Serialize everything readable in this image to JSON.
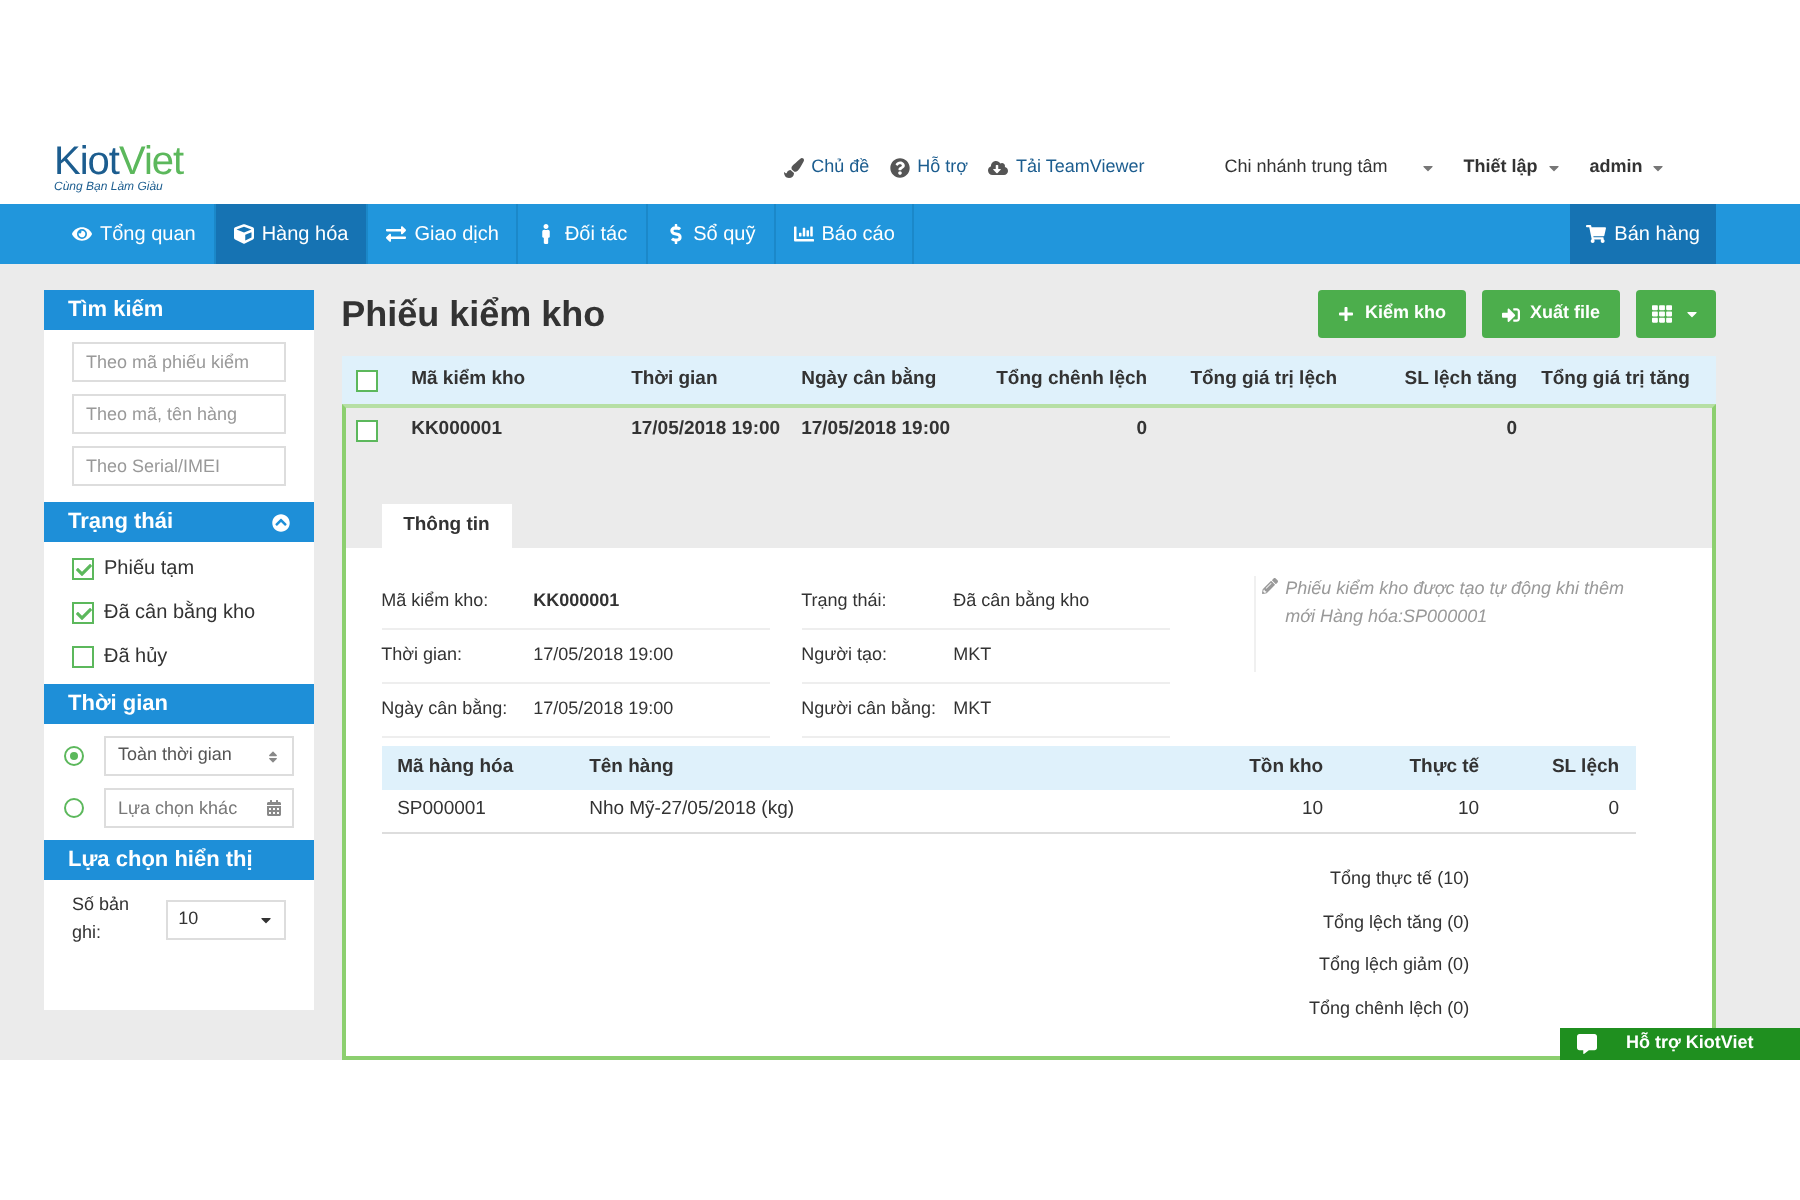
{
  "logo": {
    "part_1": "Kiot",
    "part_2": "Viet",
    "tagline": "Cùng Bạn Làm Giàu"
  },
  "header_links": [
    "Chủ đề",
    "Hỗ trợ",
    "Tải TeamViewer"
  ],
  "header_menus": [
    "Chi nhánh trung tâm",
    "Thiết lập",
    "admin"
  ],
  "nav": [
    {
      "label": "Tổng quan",
      "selected": false
    },
    {
      "label": "Hàng hóa",
      "selected": true
    },
    {
      "label": "Giao dịch",
      "selected": false
    },
    {
      "label": "Đối tác",
      "selected": false
    },
    {
      "label": "Sổ quỹ",
      "selected": false
    },
    {
      "label": "Báo cáo",
      "selected": false
    }
  ],
  "sell_button": "Bán hàng",
  "sidebar": {
    "search": {
      "title": "Tìm kiếm",
      "fields": [
        {
          "placeholder": "Theo mã phiếu kiểm"
        },
        {
          "placeholder": "Theo mã, tên hàng"
        },
        {
          "placeholder": "Theo Serial/IMEI"
        }
      ]
    },
    "status": {
      "title": "Trạng thái",
      "expanded": true,
      "options": [
        {
          "label": "Phiếu tạm",
          "checked": true
        },
        {
          "label": "Đã cân bằng kho",
          "checked": true
        },
        {
          "label": "Đã hủy",
          "checked": false
        }
      ]
    },
    "time": {
      "title": "Thời gian",
      "options": [
        {
          "kind": "select",
          "value": "Toàn thời gian",
          "selected": true
        },
        {
          "kind": "date",
          "placeholder": "Lựa chọn khác",
          "selected": false
        }
      ]
    },
    "display": {
      "title": "Lựa chọn hiển thị",
      "label": "Số bản ghi:",
      "value": "10"
    }
  },
  "page_title": "Phiếu kiểm kho",
  "actions": [
    "Kiểm kho",
    "Xuất file"
  ],
  "table": {
    "checked": false,
    "columns": [
      "Mã kiểm kho",
      "Thời gian",
      "Ngày cân bằng",
      "Tổng chênh lệch",
      "Tổng giá trị lệch",
      "SL lệch tăng",
      "Tổng giá trị tăng"
    ],
    "rows": [
      {
        "checked": false,
        "expanded": true,
        "cells": [
          "KK000001",
          "17/05/2018 19:00",
          "17/05/2018 19:00",
          "0",
          null,
          "0",
          null
        ]
      }
    ]
  },
  "detail": {
    "tabs": [
      {
        "label": "Thông tin",
        "selected": true
      }
    ],
    "fields": [
      {
        "label": "Mã kiểm kho:",
        "value": "KK000001",
        "bold": true
      },
      {
        "label": "Trạng thái:",
        "value": "Đã cân bằng kho",
        "bold": false
      },
      {
        "label": "Thời gian:",
        "value": "17/05/2018 19:00",
        "bold": false
      },
      {
        "label": "Người tạo:",
        "value": "MKT",
        "bold": false
      },
      {
        "label": "Ngày cân bằng:",
        "value": "17/05/2018 19:00",
        "bold": false
      },
      {
        "label": "Người cân bằng:",
        "value": "MKT",
        "bold": false
      }
    ],
    "note": "Phiếu kiểm kho được tạo tự động khi thêm mới Hàng hóa:SP000001",
    "items": {
      "columns": [
        "Mã hàng hóa",
        "Tên hàng",
        "Tồn kho",
        "Thực tế",
        "SL lệch"
      ],
      "rows": [
        [
          "SP000001",
          "Nho Mỹ-27/05/2018 (kg)",
          "10",
          "10",
          "0"
        ]
      ]
    },
    "totals": [
      "Tổng thực tế (10)",
      "Tổng lệch tăng (0)",
      "Tổng lệch giảm (0)",
      "Tổng chênh lệch (0)"
    ]
  },
  "support_button": "Hỗ trợ KiotViet"
}
